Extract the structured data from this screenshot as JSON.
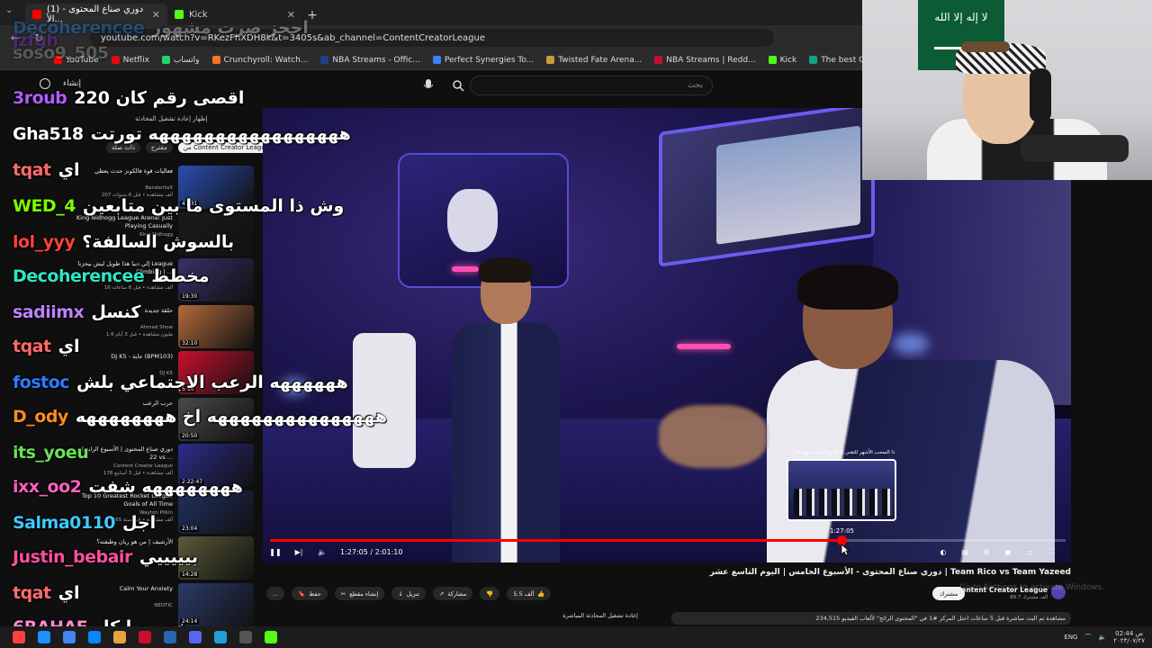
{
  "browser": {
    "tabs": [
      {
        "title": "(1) دوري صناع المحتوى - الأ...",
        "active": true,
        "color": "#ff0000"
      },
      {
        "title": "Kick",
        "active": false,
        "color": "#53fc18"
      }
    ],
    "new_tab": "+",
    "url": "youtube.com/watch?v=RKezFhXDH8k&t=3405s&ab_channel=ContentCreatorLeague",
    "bookmarks": [
      "YouTube",
      "Netflix",
      "واتساب",
      "Crunchyroll: Watch...",
      "NBA Streams - Offic...",
      "Perfect Synergies To...",
      "Twisted Fate Arena...",
      "NBA Streams | Redd...",
      "Kick",
      "The best ChatBot an..."
    ]
  },
  "youtube": {
    "search_placeholder": "بحث",
    "create_label": "إنشاء"
  },
  "related": {
    "live_chat_toggle": "إظهار إعادة تشغيل المحادثة",
    "chips": [
      {
        "label": "من Content Creator League",
        "selected": true
      },
      {
        "label": "مقترح",
        "selected": false
      },
      {
        "label": "ذات صلة",
        "selected": false
      }
    ],
    "videos": [
      {
        "title": "فعاليات قوة فالكونز حدث يعطي",
        "channel": "BanderitaX",
        "meta": "207 ألف مشاهدة • قبل 6 سنوات",
        "duration": "47:31",
        "color": "#2a4fb0"
      },
      {
        "title": "King Nidhogg League Arena! Just Playing Casually",
        "channel": "King Nidhogg",
        "meta": "",
        "duration": "",
        "color": "#1a1a1a"
      },
      {
        "title": "إلي دنيا هذا طويل ليش بيحزنا League Climbing | ...",
        "channel": "",
        "meta": "16 ألف مشاهدة • قبل 6 ساعات",
        "duration": "19:30",
        "color": "#3a2f6a"
      },
      {
        "title": "حلقة جديدة",
        "channel": "Ahmad Show",
        "meta": "1.6 مليون مشاهدة • قبل 3 أيام",
        "duration": "32:10",
        "color": "#b36a3c"
      },
      {
        "title": "DJ K5 - جاية (BPM103)",
        "channel": "DJ K5",
        "meta": "",
        "duration": "5:16",
        "color": "#c8102e"
      },
      {
        "title": "حرب الرعب",
        "channel": "",
        "meta": "",
        "duration": "20:50",
        "color": "#4a4a4a"
      },
      {
        "title": "دوري صناع المحتوى | الأسبوع الرابع | 22 vs ...",
        "channel": "Content Creator League",
        "meta": "178 ألف مشاهدة • قبل 3 أسابيع",
        "duration": "2:22:47",
        "color": "#2c2c8a"
      },
      {
        "title": "Top 10 Greatest Rocket League Goals of All Time",
        "channel": "Wayton Pilkin",
        "meta": "365 ألف مشاهدة • قبل سنة",
        "duration": "23:04",
        "color": "#203060"
      },
      {
        "title": "الأرشيف | من هو ريان وطبقته؟",
        "channel": "",
        "meta": "",
        "duration": "14:28",
        "color": "#5a5a3a"
      },
      {
        "title": "Calm Your Anxiety",
        "channel": "NEOTIC",
        "meta": "",
        "duration": "24:14",
        "color": "#2b3a6a"
      }
    ]
  },
  "chat": [
    {
      "user": "Decoherencee",
      "color": "#1e90ff",
      "message": "احجز صرت مشهور",
      "ghost": true
    },
    {
      "user": "jzfgh",
      "color": "#8a2be2",
      "message": "",
      "ghost": true
    },
    {
      "user": "soso9_505",
      "color": "#b0b0b0",
      "message": "",
      "ghost": true
    },
    {
      "user": "3roub",
      "color": "#b05cff",
      "message": "اقصى رقم كان 220"
    },
    {
      "user": "Gha518",
      "color": "#ffffff",
      "message": "هههههههههههههههههه تورتت"
    },
    {
      "user": "tqat",
      "color": "#ff6a6a",
      "message": "اي"
    },
    {
      "user": "WED_4",
      "color": "#7cfc00",
      "message": "وش ذا المستوى ما بين متابعين"
    },
    {
      "user": "lol_yyy",
      "color": "#ff4040",
      "message": "بالسوش السالفة؟"
    },
    {
      "user": "Decoherencee",
      "color": "#2ee6c8",
      "message": "مخطط"
    },
    {
      "user": "sadiimx",
      "color": "#c080ff",
      "message": "كنسل"
    },
    {
      "user": "tqat",
      "color": "#ff6a6a",
      "message": "اي"
    },
    {
      "user": "fostoc",
      "color": "#2e7bff",
      "message": "ههههههه الرعب الاجتماعي بلش"
    },
    {
      "user": "D_ody",
      "color": "#ff8c1a",
      "message": "هههههههههههههههه اخ ههههههههه"
    },
    {
      "user": "its_yoeu",
      "color": "#6be05a",
      "message": ""
    },
    {
      "user": "ixx_oo2",
      "color": "#ff5fc0",
      "message": "ههههههههه شفت"
    },
    {
      "user": "Salma0110",
      "color": "#3ec8ff",
      "message": "اجل"
    },
    {
      "user": "Justin_bebair",
      "color": "#ff4fa0",
      "message": "بيييييي"
    },
    {
      "user": "tqat",
      "color": "#ff6a6a",
      "message": "اي"
    },
    {
      "user": "6RAHAF",
      "color": "#ff8ad0",
      "message": "خصوصا كل"
    }
  ],
  "player": {
    "current_time": "1:27:05",
    "duration": "2:01:10",
    "time_display": "1:27:05 / 2:01:10",
    "progress": 0.718,
    "hover_time": "1:27:05",
    "hover_chapter": "ذا السحب الأشهر للتقني إذ الثروة الشعب ويلا نكر",
    "brand_overlay": "CONTENT"
  },
  "video": {
    "title": "دوري صناع المحتوى - الأسبوع الخامس | اليوم التاسع عشر | Team Rico vs Team Yazeed",
    "channel": "Content Creator League",
    "subscribers": "89.7 ألف مشترك",
    "subscribe_label": "مشترك",
    "likes": "5.5 ألف",
    "share_label": "مشاركة",
    "download_label": "تنزيل",
    "clip_label": "إنشاء مقطع",
    "save_label": "حفظ",
    "more_label": "...",
    "description": "234,515 مشاهدة  تم البث مباشرة قبل 5 ساعات  احتل المركز #1 في \"المحتوى الرائج\" لألعاب الفيديو",
    "live_chat_replay": "إعادة تشغيل المحادثة المباشرة",
    "windows_watermark": "Go to Settings to activate Windows."
  },
  "webcam": {
    "flag_text": "لا إله إلا الله"
  },
  "taskbar": {
    "lang": "ENG",
    "time": "02:44 ص",
    "date": "٢٠٢٣/٠٧/٢٧",
    "icons": [
      "#ff4040",
      "#1e90ff",
      "#4285f4",
      "#0a84ff",
      "#e8a33d",
      "#c8102e",
      "#2b66b3",
      "#5865f2",
      "#229ed9",
      "#555555",
      "#53fc18"
    ]
  }
}
